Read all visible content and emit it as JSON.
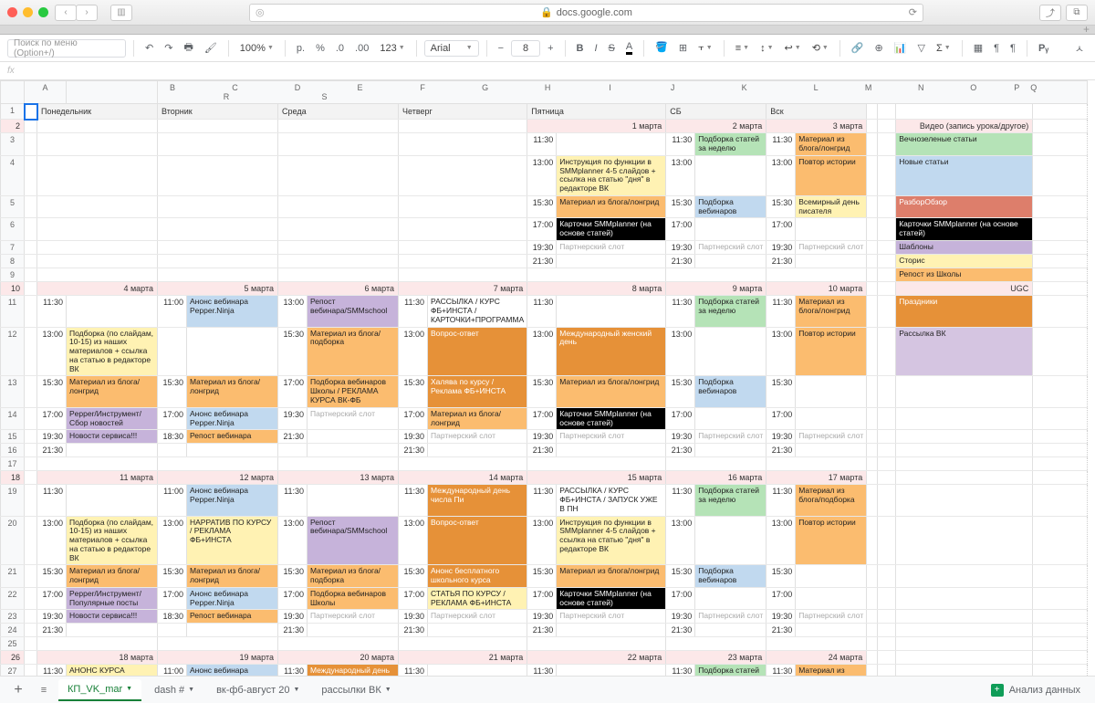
{
  "browser": {
    "url": "docs.google.com",
    "plus_tab": "+",
    "search_placeholder": "Поиск по меню (Option+/)"
  },
  "toolbar": {
    "zoom": "100%",
    "currency": "р.",
    "percent": "%",
    "dec_dec": ".0",
    "dec_inc": ".00",
    "num_fmt": "123",
    "font": "Arial",
    "size": "8",
    "bold": "B",
    "italic": "I",
    "strike": "S",
    "textcolor": "A",
    "py": "Pᵧ"
  },
  "fx": "fx",
  "cols": [
    "A",
    "B",
    "C",
    "D",
    "E",
    "F",
    "G",
    "H",
    "I",
    "J",
    "K",
    "L",
    "M",
    "N",
    "O",
    "P",
    "Q",
    "R",
    "S"
  ],
  "dayhead": {
    "mon": "Понедельник",
    "tue": "Вторник",
    "wed": "Среда",
    "thu": "Четверг",
    "fri": "Пятница",
    "sat": "СБ",
    "sun": "Вск"
  },
  "dates": {
    "w1": {
      "fri": "1 марта",
      "sat": "2 марта",
      "sun": "3 марта"
    },
    "w2": {
      "mon": "4 марта",
      "tue": "5 марта",
      "wed": "6 марта",
      "thu": "7 марта",
      "fri": "8 марта",
      "sat": "9 марта",
      "sun": "10 марта"
    },
    "w3": {
      "mon": "11 марта",
      "tue": "12 марта",
      "wed": "13 марта",
      "thu": "14 марта",
      "fri": "15 марта",
      "sat": "16 марта",
      "sun": "17 марта"
    },
    "w4": {
      "mon": "18 марта",
      "tue": "19 марта",
      "wed": "20 марта",
      "thu": "21 марта",
      "fri": "22 марта",
      "sat": "23 марта",
      "sun": "24 марта"
    }
  },
  "times": {
    "t1130": "11:30",
    "t1100": "11:00",
    "t1300": "13:00",
    "t1530": "15:30",
    "t1700": "17:00",
    "t1830": "18:30",
    "t1930": "19:30",
    "t2130": "21:30"
  },
  "ev": {
    "podborka_week": "Подборка статей за неделю",
    "mat_blog_long": "Материал из блога/лонгрид",
    "mat_blog_podb": "Материал из блога/подборка",
    "instr_smm": "Инструкция по функции в SMMplanner 4-5 слайдов + ссылка на статью \"дня\" в редакторе ВК",
    "povtor": "Повтор истории",
    "podb_web": "Подборка вебинаров",
    "pisatel": "Всемирный день писателя",
    "kartochki": "Карточки SMMplanner (на основе статей)",
    "partner": "Партнерский слот",
    "anons_pepper": "Анонс вебинара Pepper.Ninja",
    "repost_smmsch": "Репост вебинара/SMMschool",
    "repost_web": "Репост вебинара",
    "rassylka_prog": "РАССЫЛКА / КУРС ФБ+ИНСТА / КАРТОЧКИ+ПРОГРАММА",
    "rassylka_zapusk": "РАССЫЛКА / КУРС ФБ+ИНСТА / ЗАПУСК УЖЕ В ПН",
    "podb_sliders": "Подборка (по слайдам, 10-15) из наших материалов + ссылка на статью в редакторе ВК",
    "podb_web_vkfb": "Подборка вебинаров Школы / РЕКЛАМА КУРСА ВК-ФБ",
    "podb_web_shk": "Подборка вебинаров Школы",
    "vopros": "Вопрос-ответ",
    "mzhd": "Международный женский день",
    "mdpi": "Международный день числа Пи",
    "mdn": "Международный день",
    "halava": "Халява по курсу / Реклама ФБ+ИНСТА",
    "narr": "НАРРАТИВ ПО КУРСУ / РЕКЛАМА ФБ+ИНСТА",
    "pepper_sbor": "Pepper/Инструмент/Сбор новостей",
    "pepper_pop": "Pepper/Инструмент/Популярные посты",
    "novosti": "Новости сервиса!!!",
    "anons_besp": "Анонс бесплатного школьного курса",
    "statya_kurs": "СТАТЬЯ ПО КУРСУ / РЕКЛАМА ФБ+ИНСТА",
    "anons_kursa": "АНОНС КУРСА"
  },
  "legend": {
    "video": "Видео (запись урока/другое)",
    "evergreen": "Вечнозеленые статьи",
    "new": "Новые статьи",
    "razbor": "РазборОбзор",
    "kart": "Карточки SMMplanner (на основе статей)",
    "shab": "Шаблоны",
    "storis": "Сторис",
    "repost": "Репост из Школы",
    "ugc": "UGC",
    "prazd": "Праздники",
    "rassvk": "Рассылка ВК"
  },
  "tabs": {
    "t1": "КП_VK_mar",
    "t2": "dash #",
    "t3": "вк-фб-август 20",
    "t4": "рассылки ВК",
    "analyze": "Анализ данных"
  }
}
